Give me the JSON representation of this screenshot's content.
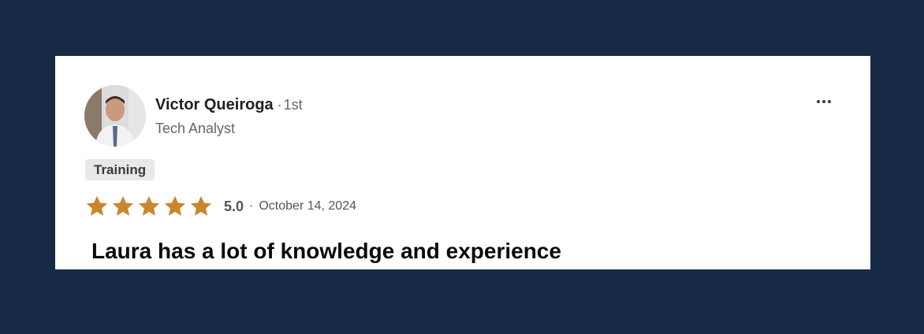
{
  "reviewer": {
    "name": "Victor Queiroga",
    "separator": "·",
    "degree": "1st",
    "headline": "Tech Analyst"
  },
  "service_tag": "Training",
  "rating": {
    "value": 5.0,
    "max": 5,
    "label": "5.0",
    "separator": "·",
    "date": "October 14, 2024"
  },
  "review": {
    "text": "Laura has a lot of knowledge and experience"
  },
  "icons": {
    "more": "more-horizontal-icon",
    "star": "star-icon"
  },
  "colors": {
    "background": "#172a45",
    "card": "#ffffff",
    "star": "#c8862e",
    "tag_bg": "#e8e8e8"
  }
}
